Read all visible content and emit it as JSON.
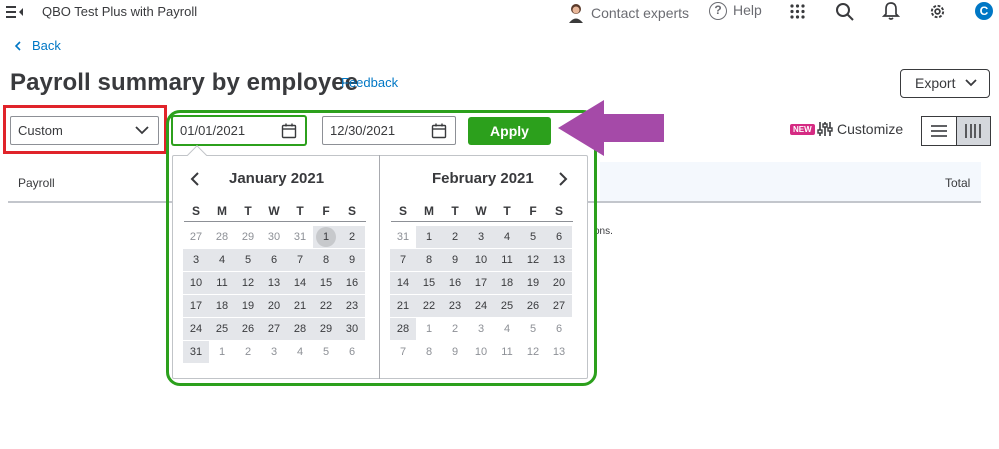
{
  "app": {
    "title": "QBO Test Plus with Payroll"
  },
  "topbar": {
    "contact": "Contact experts",
    "help": "Help",
    "avatar_letter": "C"
  },
  "nav": {
    "back": "Back"
  },
  "page": {
    "title": "Payroll summary by employee",
    "feedback": "Feedback",
    "export": "Export"
  },
  "filters": {
    "period": "Custom",
    "start_date": "01/01/2021",
    "end_date": "12/30/2021",
    "apply": "Apply"
  },
  "toolbar": {
    "new_badge": "NEW",
    "customize": "Customize"
  },
  "table": {
    "col_payroll": "Payroll",
    "col_total": "Total",
    "partial_text": "ons."
  },
  "calendar": {
    "dow": [
      "S",
      "M",
      "T",
      "W",
      "T",
      "F",
      "S"
    ],
    "months": [
      {
        "title": "January 2021",
        "weeks": [
          [
            {
              "d": "27",
              "o": true
            },
            {
              "d": "28",
              "o": true
            },
            {
              "d": "29",
              "o": true
            },
            {
              "d": "30",
              "o": true
            },
            {
              "d": "31",
              "o": true
            },
            {
              "d": "1",
              "sel": true
            },
            {
              "d": "2"
            }
          ],
          [
            {
              "d": "3"
            },
            {
              "d": "4"
            },
            {
              "d": "5"
            },
            {
              "d": "6"
            },
            {
              "d": "7"
            },
            {
              "d": "8"
            },
            {
              "d": "9"
            }
          ],
          [
            {
              "d": "10"
            },
            {
              "d": "11"
            },
            {
              "d": "12"
            },
            {
              "d": "13"
            },
            {
              "d": "14"
            },
            {
              "d": "15"
            },
            {
              "d": "16"
            }
          ],
          [
            {
              "d": "17"
            },
            {
              "d": "18"
            },
            {
              "d": "19"
            },
            {
              "d": "20"
            },
            {
              "d": "21"
            },
            {
              "d": "22"
            },
            {
              "d": "23"
            }
          ],
          [
            {
              "d": "24"
            },
            {
              "d": "25"
            },
            {
              "d": "26"
            },
            {
              "d": "27"
            },
            {
              "d": "28"
            },
            {
              "d": "29"
            },
            {
              "d": "30"
            }
          ],
          [
            {
              "d": "31"
            },
            {
              "d": "1",
              "o": true
            },
            {
              "d": "2",
              "o": true
            },
            {
              "d": "3",
              "o": true
            },
            {
              "d": "4",
              "o": true
            },
            {
              "d": "5",
              "o": true
            },
            {
              "d": "6",
              "o": true
            }
          ]
        ]
      },
      {
        "title": "February 2021",
        "weeks": [
          [
            {
              "d": "31",
              "o": true
            },
            {
              "d": "1"
            },
            {
              "d": "2"
            },
            {
              "d": "3"
            },
            {
              "d": "4"
            },
            {
              "d": "5"
            },
            {
              "d": "6"
            }
          ],
          [
            {
              "d": "7"
            },
            {
              "d": "8"
            },
            {
              "d": "9"
            },
            {
              "d": "10"
            },
            {
              "d": "11"
            },
            {
              "d": "12"
            },
            {
              "d": "13"
            }
          ],
          [
            {
              "d": "14"
            },
            {
              "d": "15"
            },
            {
              "d": "16"
            },
            {
              "d": "17"
            },
            {
              "d": "18"
            },
            {
              "d": "19"
            },
            {
              "d": "20"
            }
          ],
          [
            {
              "d": "21"
            },
            {
              "d": "22"
            },
            {
              "d": "23"
            },
            {
              "d": "24"
            },
            {
              "d": "25"
            },
            {
              "d": "26"
            },
            {
              "d": "27"
            }
          ],
          [
            {
              "d": "28"
            },
            {
              "d": "1",
              "o": true
            },
            {
              "d": "2",
              "o": true
            },
            {
              "d": "3",
              "o": true
            },
            {
              "d": "4",
              "o": true
            },
            {
              "d": "5",
              "o": true
            },
            {
              "d": "6",
              "o": true
            }
          ],
          [
            {
              "d": "7",
              "o": true
            },
            {
              "d": "8",
              "o": true
            },
            {
              "d": "9",
              "o": true
            },
            {
              "d": "10",
              "o": true
            },
            {
              "d": "11",
              "o": true
            },
            {
              "d": "12",
              "o": true
            },
            {
              "d": "13",
              "o": true
            }
          ]
        ]
      }
    ]
  },
  "colors": {
    "accent_green": "#2ca01c",
    "link_blue": "#0077c5",
    "annotation_red": "#e0232a",
    "annotation_purple": "#a54aa8"
  }
}
